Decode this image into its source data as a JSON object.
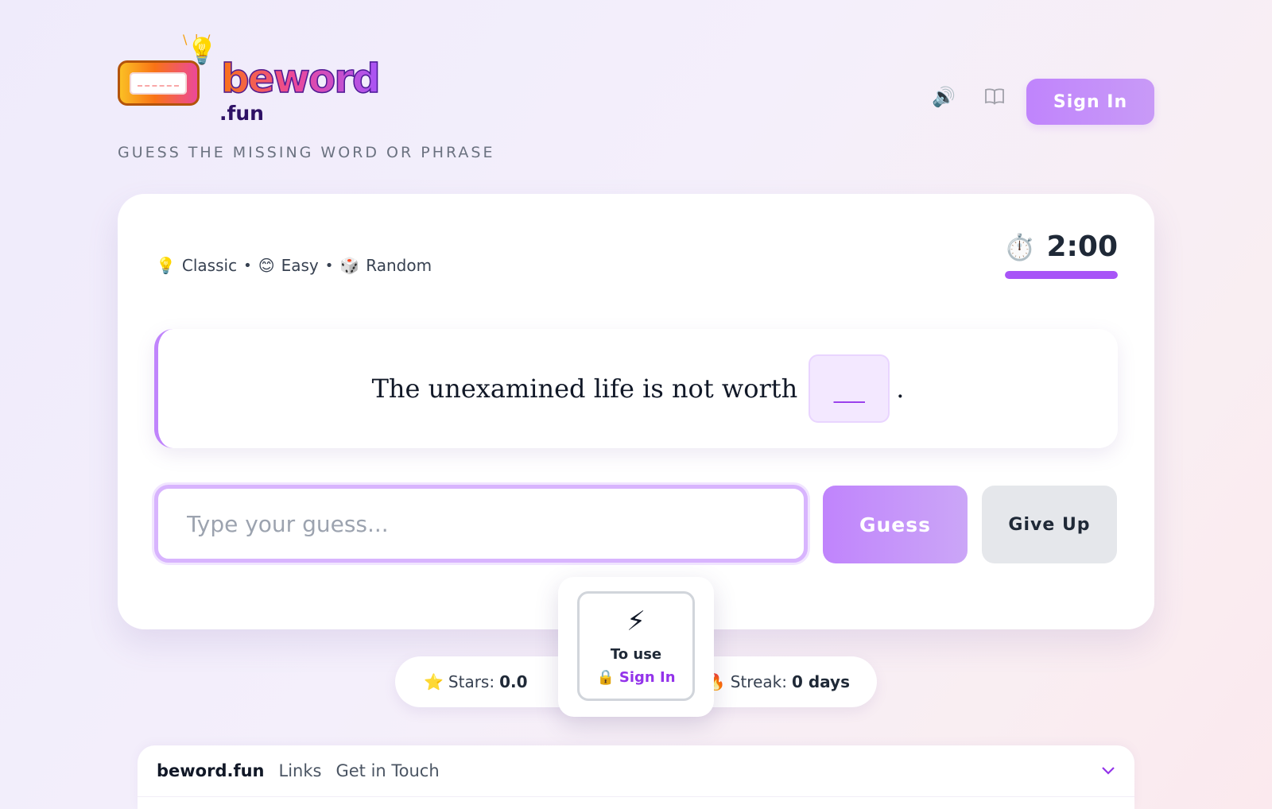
{
  "header": {
    "logo_word": "beword",
    "logo_suffix": ".fun",
    "tagline": "GUESS THE MISSING WORD OR PHRASE",
    "sound_icon": "speaker-icon",
    "book_icon": "book-icon",
    "sign_in_label": "Sign In"
  },
  "game": {
    "mode": "Classic",
    "difficulty": "Easy",
    "category": "Random",
    "separator": "•",
    "mode_icon": "💡",
    "difficulty_icon": "😊",
    "category_icon": "🎲",
    "timer": "2:00",
    "timer_icon": "⏱️",
    "timer_fraction": 1.0,
    "phrase_before": "The unexamined life is not worth",
    "blank": "___",
    "phrase_after": "."
  },
  "guess": {
    "placeholder": "Type your guess...",
    "value": "",
    "guess_label": "Guess",
    "give_up_label": "Give Up"
  },
  "stats": {
    "stars_label": "Stars:",
    "stars_value": "0.0",
    "streak_label": "Streak:",
    "streak_value": "0 days"
  },
  "popup": {
    "icon": "⚡",
    "text": "To use",
    "sign_in_label": "Sign In",
    "lock_icon": "🔒"
  },
  "footer": {
    "brand": "beword.fun",
    "links": [
      "Links",
      "Get in Touch"
    ]
  },
  "colors": {
    "accent": "#a855f7",
    "accent_light": "#c084fc",
    "give_up_bg": "#e5e7eb"
  }
}
